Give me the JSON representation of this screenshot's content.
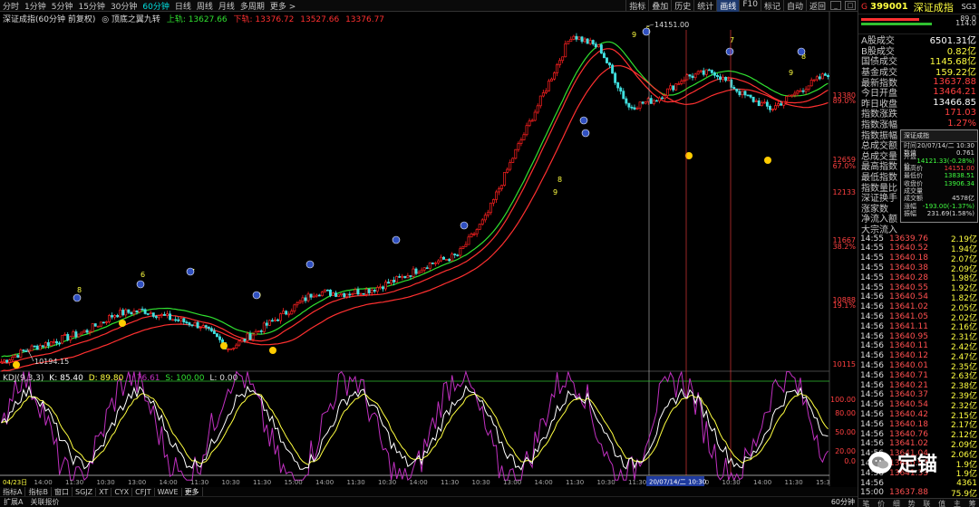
{
  "toolbar": {
    "periods": [
      "分时",
      "1分钟",
      "5分钟",
      "15分钟",
      "30分钟",
      "60分钟",
      "日线",
      "周线",
      "月线",
      "多周期",
      "更多 >"
    ],
    "active_period": 5,
    "tools": [
      "指标",
      "叠加",
      "历史",
      "统计",
      "画线",
      "F10",
      "标记",
      "自动",
      "返回"
    ],
    "active_tool": 4
  },
  "main_legend": {
    "index_name": "深证成指(60分钟 前复权)",
    "indicator": "◎ 顶底之翼九转",
    "upper_label": "上轨: 13627.66",
    "lower_label": "下轨: 13376.72",
    "mid_label": "13527.66",
    "mid2_label": "13376.77"
  },
  "price_axis": [
    "13380",
    "89.0%",
    "12659",
    "67.0%",
    "12133",
    "11667",
    "38.2%",
    "10888",
    "19.1%",
    "10115"
  ],
  "annotations": {
    "high": "14151.00",
    "low": "10194.15",
    "nine_marks": [
      "6",
      "7",
      "8",
      "9",
      "9",
      "6",
      "7",
      "8",
      "9",
      "8",
      "9"
    ]
  },
  "kdj_legend": {
    "name": "KDJ(9,3,3)",
    "k": "K: 85.40",
    "d": "D: 89.80",
    "j": "J: 76.61",
    "s": "S: 100.00",
    "l": "L: 0.00"
  },
  "kdj_axis": [
    "100.00",
    "80.00",
    "50.00",
    "20.00",
    "0.0"
  ],
  "time_axis": [
    "04/23日",
    "14:00",
    "11:30",
    "10:30",
    "13:00",
    "14:00",
    "11:30",
    "10:30",
    "11:30",
    "15:00",
    "14:00",
    "11:30",
    "10:30",
    "14:00",
    "11:30",
    "10:30",
    "13:00",
    "14:00",
    "11:30",
    "10:30",
    "11:30",
    "14:00",
    "11:30",
    "10:30",
    "14:00",
    "11:30",
    "15:3"
  ],
  "crosshair_date": "20/07/14/二 10:30",
  "tabs1": [
    "指标A",
    "指标B",
    "窗口",
    "SGJZ",
    "XT",
    "CYX",
    "CFJT",
    "WAVE",
    "更多"
  ],
  "tabs2": [
    "扩展A",
    "关联报价"
  ],
  "bottom_right_label": "60分钟",
  "panel": {
    "marker": "G",
    "code": "399001",
    "name": "深证成指",
    "num": "SG3",
    "bars": [
      {
        "value": "89.0",
        "fill": 0.72,
        "color": "#ff3030"
      },
      {
        "value": "114.0",
        "fill": 0.88,
        "color": "#30c030"
      }
    ],
    "stats": [
      {
        "label": "A股成交",
        "value": "6501.31亿",
        "color": "#ffffff"
      },
      {
        "label": "B股成交",
        "value": "0.82亿",
        "color": "#ffff40"
      },
      {
        "label": "国债成交",
        "value": "1145.68亿",
        "color": "#ffff40"
      },
      {
        "label": "基金成交",
        "value": "159.22亿",
        "color": "#ffff40"
      },
      {
        "label": "最新指数",
        "value": "13637.88",
        "color": "#ff4040"
      },
      {
        "label": "今日开盘",
        "value": "13464.21",
        "color": "#ff4040"
      },
      {
        "label": "昨日收盘",
        "value": "13466.85",
        "color": "#ffffff"
      },
      {
        "label": "指数涨跌",
        "value": "171.03",
        "color": "#ff4040"
      },
      {
        "label": "指数涨幅",
        "value": "1.27%",
        "color": "#ff4040"
      },
      {
        "label": "指数振幅",
        "value": "240.17/2.59%",
        "color": "#ffffff"
      },
      {
        "label": "总成交额",
        "value": "",
        "color": "#ffffff"
      },
      {
        "label": "总成交量",
        "value": "",
        "color": "#ffffff"
      },
      {
        "label": "最高指数",
        "value": "",
        "color": "#ffffff"
      },
      {
        "label": "最低指数",
        "value": "",
        "color": "#ffffff"
      },
      {
        "label": "指数量比",
        "value": "",
        "color": "#ffffff"
      },
      {
        "label": "深证换手",
        "value": "",
        "color": "#ffffff"
      },
      {
        "label": "涨家数",
        "value": "",
        "color": "#ffffff"
      },
      {
        "label": "净流入额",
        "value": "",
        "color": "#ffffff"
      },
      {
        "label": "大宗流入",
        "value": "",
        "color": "#ffffff"
      }
    ],
    "ticks": [
      {
        "t": "14:55",
        "p": "13639.76",
        "v": "2.19亿"
      },
      {
        "t": "14:55",
        "p": "13640.52",
        "v": "1.94亿"
      },
      {
        "t": "14:55",
        "p": "13640.18",
        "v": "2.07亿"
      },
      {
        "t": "14:55",
        "p": "13640.38",
        "v": "2.09亿"
      },
      {
        "t": "14:55",
        "p": "13640.28",
        "v": "1.98亿"
      },
      {
        "t": "14:55",
        "p": "13640.55",
        "v": "1.92亿"
      },
      {
        "t": "14:56",
        "p": "13640.54",
        "v": "1.82亿"
      },
      {
        "t": "14:56",
        "p": "13641.02",
        "v": "2.05亿"
      },
      {
        "t": "14:56",
        "p": "13641.05",
        "v": "2.02亿"
      },
      {
        "t": "14:56",
        "p": "13641.11",
        "v": "2.16亿"
      },
      {
        "t": "14:56",
        "p": "13640.95",
        "v": "2.31亿"
      },
      {
        "t": "14:56",
        "p": "13640.11",
        "v": "2.42亿"
      },
      {
        "t": "14:56",
        "p": "13640.12",
        "v": "2.47亿"
      },
      {
        "t": "14:56",
        "p": "13640.01",
        "v": "2.35亿"
      },
      {
        "t": "14:56",
        "p": "13640.71",
        "v": "2.63亿"
      },
      {
        "t": "14:56",
        "p": "13640.21",
        "v": "2.38亿"
      },
      {
        "t": "14:56",
        "p": "13640.37",
        "v": "2.39亿"
      },
      {
        "t": "14:56",
        "p": "13640.54",
        "v": "2.32亿"
      },
      {
        "t": "14:56",
        "p": "13640.42",
        "v": "2.15亿"
      },
      {
        "t": "14:56",
        "p": "13640.18",
        "v": "2.17亿"
      },
      {
        "t": "14:56",
        "p": "13640.76",
        "v": "2.12亿"
      },
      {
        "t": "14:56",
        "p": "13641.02",
        "v": "2.09亿"
      },
      {
        "t": "14:56",
        "p": "13641.04",
        "v": "2.06亿"
      },
      {
        "t": "14:56",
        "p": "13640.93",
        "v": "1.9亿"
      },
      {
        "t": "14:56",
        "p": "13641.33",
        "v": "1.9亿"
      },
      {
        "t": "14:56",
        "p": "",
        "v": "4361"
      },
      {
        "t": "15:00",
        "p": "13637.88",
        "v": "75.9亿"
      }
    ],
    "footer": [
      "笔",
      "价",
      "细",
      "势",
      "联",
      "值",
      "主",
      "筹"
    ]
  },
  "popup": {
    "title": "深证成指",
    "rows": [
      {
        "k": "时间",
        "v": "20/07/14/二 10:30",
        "c": "#dddddd"
      },
      {
        "k": "数值",
        "v": "0.761",
        "c": "#dddddd"
      },
      {
        "k": "开盘价",
        "v": "14121.33(-0.28%)",
        "c": "#40ff40"
      },
      {
        "k": "最高价",
        "v": "14151.00",
        "c": "#ff4040"
      },
      {
        "k": "最低价",
        "v": "13838.51",
        "c": "#40ff40"
      },
      {
        "k": "收盘价",
        "v": "13906.34",
        "c": "#40ff40"
      },
      {
        "k": "成交量",
        "v": "",
        "c": "#dddddd"
      },
      {
        "k": "成交额",
        "v": "4578亿",
        "c": "#dddddd"
      },
      {
        "k": "涨幅",
        "v": "-193.00(-1.37%)",
        "c": "#40ff40"
      },
      {
        "k": "振幅",
        "v": "231.69(1.58%)",
        "c": "#dddddd"
      }
    ]
  },
  "watermark": "定锚",
  "colors": {
    "up": "#ff2020",
    "down": "#40e0e0",
    "upper_band": "#30e030",
    "mid_band": "#ff3030",
    "k_line": "#ffffff",
    "d_line": "#ffff40",
    "j_line": "#c030c0"
  },
  "chart_data": {
    "type": "line",
    "title": "深证成指(60分钟 前复权)",
    "series": [
      {
        "name": "深证成指",
        "values": [
          10194,
          10350,
          10450,
          10560,
          10760,
          10800,
          10700,
          10620,
          10350,
          10560,
          10780,
          11020,
          11000,
          11050,
          11180,
          11350,
          11450,
          11900,
          12650,
          13350,
          14060,
          13900,
          13200,
          13300,
          13560,
          13620,
          13350,
          13180,
          13400,
          13600
        ]
      }
    ],
    "ylim": [
      10115,
      14200
    ]
  }
}
